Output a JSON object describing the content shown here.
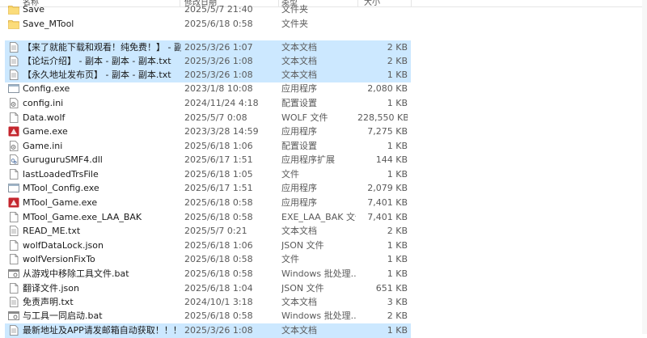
{
  "header": {
    "columns": [
      "名称",
      "修改日期",
      "类型",
      "大小"
    ]
  },
  "files": [
    {
      "icon": "folder-icon",
      "name": "Save",
      "date": "2025/5/7 21:40",
      "type": "文件夹",
      "size": "",
      "selected": false
    },
    {
      "icon": "folder-icon",
      "name": "Save_MTool",
      "date": "2025/6/18 0:58",
      "type": "文件夹",
      "size": "",
      "selected": false
    },
    {
      "icon": "text-file-icon",
      "name": "【来了就能下载和观看！纯免费！】 - 副...",
      "date": "2025/3/26 1:07",
      "type": "文本文档",
      "size": "2 KB",
      "selected": true
    },
    {
      "icon": "text-file-icon",
      "name": "【论坛介绍】 - 副本 - 副本 - 副本.txt",
      "date": "2025/3/26 1:08",
      "type": "文本文档",
      "size": "2 KB",
      "selected": true
    },
    {
      "icon": "text-file-icon",
      "name": "【永久地址发布页】 - 副本 - 副本.txt",
      "date": "2025/3/26 1:08",
      "type": "文本文档",
      "size": "1 KB",
      "selected": true
    },
    {
      "icon": "exe-window-icon",
      "name": "Config.exe",
      "date": "2023/1/8 10:08",
      "type": "应用程序",
      "size": "2,080 KB",
      "selected": false
    },
    {
      "icon": "settings-file-icon",
      "name": "config.ini",
      "date": "2024/11/24 4:18",
      "type": "配置设置",
      "size": "1 KB",
      "selected": false
    },
    {
      "icon": "blank-file-icon",
      "name": "Data.wolf",
      "date": "2025/5/7 0:08",
      "type": "WOLF 文件",
      "size": "228,550 KB",
      "selected": false
    },
    {
      "icon": "game-app-icon",
      "name": "Game.exe",
      "date": "2023/3/28 14:59",
      "type": "应用程序",
      "size": "7,275 KB",
      "selected": false
    },
    {
      "icon": "settings-file-icon",
      "name": "Game.ini",
      "date": "2025/6/18 1:06",
      "type": "配置设置",
      "size": "1 KB",
      "selected": false
    },
    {
      "icon": "dll-file-icon",
      "name": "GuruguruSMF4.dll",
      "date": "2025/6/17 1:51",
      "type": "应用程序扩展",
      "size": "144 KB",
      "selected": false
    },
    {
      "icon": "blank-file-icon",
      "name": "lastLoadedTrsFile",
      "date": "2025/6/18 1:05",
      "type": "文件",
      "size": "1 KB",
      "selected": false
    },
    {
      "icon": "exe-window-icon",
      "name": "MTool_Config.exe",
      "date": "2025/6/17 1:51",
      "type": "应用程序",
      "size": "2,079 KB",
      "selected": false
    },
    {
      "icon": "game-app-icon",
      "name": "MTool_Game.exe",
      "date": "2025/6/18 0:58",
      "type": "应用程序",
      "size": "7,401 KB",
      "selected": false
    },
    {
      "icon": "blank-file-icon",
      "name": "MTool_Game.exe_LAA_BAK",
      "date": "2025/6/18 0:58",
      "type": "EXE_LAA_BAK 文件",
      "size": "7,401 KB",
      "selected": false
    },
    {
      "icon": "text-file-icon",
      "name": "READ_ME.txt",
      "date": "2025/5/7 0:21",
      "type": "文本文档",
      "size": "2 KB",
      "selected": false
    },
    {
      "icon": "blank-file-icon",
      "name": "wolfDataLock.json",
      "date": "2025/6/18 1:06",
      "type": "JSON 文件",
      "size": "1 KB",
      "selected": false
    },
    {
      "icon": "blank-file-icon",
      "name": "wolfVersionFixTo",
      "date": "2025/6/18 0:58",
      "type": "文件",
      "size": "1 KB",
      "selected": false
    },
    {
      "icon": "batch-file-icon",
      "name": "从游戏中移除工具文件.bat",
      "date": "2025/6/18 0:58",
      "type": "Windows 批处理...",
      "size": "1 KB",
      "selected": false
    },
    {
      "icon": "blank-file-icon",
      "name": "翻译文件.json",
      "date": "2025/6/18 1:04",
      "type": "JSON 文件",
      "size": "651 KB",
      "selected": false
    },
    {
      "icon": "text-file-icon",
      "name": "免责声明.txt",
      "date": "2024/10/1 3:18",
      "type": "文本文档",
      "size": "3 KB",
      "selected": false
    },
    {
      "icon": "batch-file-icon",
      "name": "与工具一同启动.bat",
      "date": "2025/6/18 0:58",
      "type": "Windows 批处理...",
      "size": "2 KB",
      "selected": false
    },
    {
      "icon": "text-file-icon",
      "name": "最新地址及APP请发邮箱自动获取！！！...",
      "date": "2025/3/26 1:08",
      "type": "文本文档",
      "size": "1 KB",
      "selected": true
    }
  ],
  "colors": {
    "selection": "#cce8ff",
    "folder": "#f8d568",
    "muted_text": "#5a5a5a"
  }
}
